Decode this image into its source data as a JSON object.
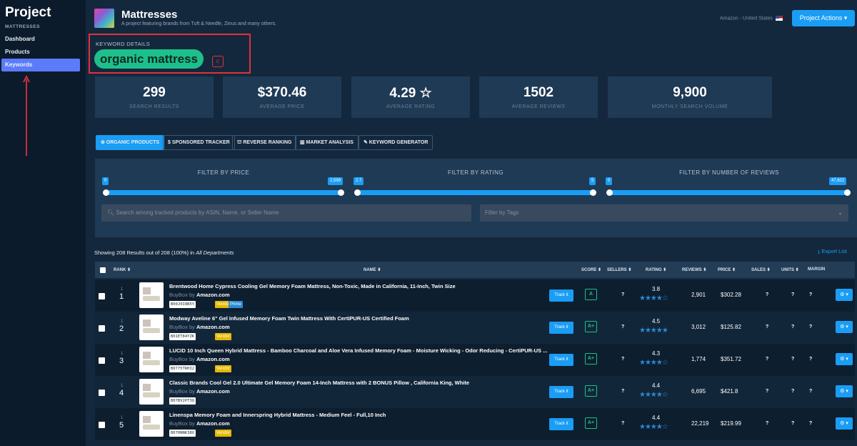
{
  "sidebar": {
    "title": "Project",
    "subtitle": "MATTRESSES",
    "items": [
      {
        "label": "Dashboard"
      },
      {
        "label": "Products"
      },
      {
        "label": "Keywords"
      }
    ]
  },
  "header": {
    "title": "Mattresses",
    "subtitle": "A project featuring brands from Tuft & Needle, Zinus and many others.",
    "market": "Amazon - United States",
    "actions": "Project Actions ▾"
  },
  "keyword": {
    "section_label": "KEYWORD DETAILS",
    "term": "organic mattress",
    "badge": "c"
  },
  "stats": [
    {
      "value": "299",
      "label": "SEARCH RESULTS"
    },
    {
      "value": "$370.46",
      "label": "AVERAGE PRICE"
    },
    {
      "value": "4.29 ☆",
      "label": "AVERAGE RATING"
    },
    {
      "value": "1502",
      "label": "AVERAGE REVIEWS"
    },
    {
      "value": "9,900",
      "label": "MONTHLY SEARCH VOLUME"
    }
  ],
  "tabs": [
    {
      "label": "⊕ ORGANIC PRODUCTS"
    },
    {
      "label": "$ SPONSORED TRACKER"
    },
    {
      "label": "⛫ REVERSE RANKING"
    },
    {
      "label": "▥ MARKET ANALYSIS"
    },
    {
      "label": "✎ KEYWORD GENERATOR"
    }
  ],
  "filters": {
    "price": {
      "label": "FILTER BY PRICE",
      "min": "0",
      "max": "2,599"
    },
    "rating": {
      "label": "FILTER BY RATING",
      "min": "2.7",
      "max": "5"
    },
    "reviews": {
      "label": "FILTER BY NUMBER OF REVIEWS",
      "min": "0",
      "max": "47,622"
    },
    "search_placeholder": "Search among tracked products by ASIN, Name, or Seller Name",
    "tags_placeholder": "Filter by Tags"
  },
  "results": {
    "summary": "Showing 208 Results out of 208 (100%) in",
    "dept": "All Departments",
    "export": "⤓ Export List"
  },
  "columns": {
    "rank": "RANK ⬍",
    "name": "NAME ⬍",
    "score": "SCORE ⬍",
    "sellers": "SELLERS ⬍",
    "rating": "RATING ⬍",
    "reviews": "REVIEWS ⬍",
    "price": "PRICE ⬍",
    "sales": "SALES ⬍",
    "units": "UNITS ⬍",
    "margin": "MARGIN"
  },
  "common": {
    "buybox": "BuyBox",
    "by": "by",
    "track": "Track it",
    "vendor": "Vendor",
    "prime": "Prime",
    "unknown": "?",
    "gear": "⚙ ▾"
  },
  "rows": [
    {
      "rank_small": "1",
      "rank": "1",
      "name": "Brentwood Home Cypress Cooling Gel Memory Foam Mattress, Non-Toxic, Made in California, 11-Inch, Twin Size",
      "seller": "Amazon.com",
      "asin": "B00J0I8N5Y",
      "score": "A",
      "rating": "3.8",
      "stars": "★★★★☆",
      "reviews": "2,901",
      "price": "$302.28"
    },
    {
      "rank_small": "1",
      "rank": "2",
      "name": "Modway Aveline 6\" Gel Infused Memory Foam Twin Mattress With CertiPUR-US Certified Foam",
      "seller": "Amazon.com",
      "asin": "B01ET84YZK",
      "score": "A+",
      "rating": "4.5",
      "stars": "★★★★★",
      "reviews": "3,012",
      "price": "$125.82"
    },
    {
      "rank_small": "1",
      "rank": "3",
      "name": "LUCID 10 Inch Queen Hybrid Mattress - Bamboo Charcoal and Aloe Vera Infused Memory Foam - Moisture Wicking - Odor Reducing - CertiPUR-US ...",
      "seller": "Amazon.com",
      "asin": "B0775TRHI2",
      "score": "A+",
      "rating": "4.3",
      "stars": "★★★★☆",
      "reviews": "1,774",
      "price": "$351.72"
    },
    {
      "rank_small": "1",
      "rank": "4",
      "name": "Classic Brands Cool Gel 2.0 Ultimate Gel Memory Foam 14-Inch Mattress with 2 BONUS Pillow , California King, White",
      "seller": "Amazon.com",
      "asin": "B07BV2PT3Q",
      "score": "A+",
      "rating": "4.4",
      "stars": "★★★★☆",
      "reviews": "6,695",
      "price": "$421.8"
    },
    {
      "rank_small": "1",
      "rank": "5",
      "name": "Linenspa Memory Foam and Innerspring Hybrid Mattress - Medium Feel - Full,10 Inch",
      "seller": "Amazon.com",
      "asin": "B07HNNK38V",
      "score": "A+",
      "rating": "4.4",
      "stars": "★★★★☆",
      "reviews": "22,219",
      "price": "$219.99"
    }
  ]
}
